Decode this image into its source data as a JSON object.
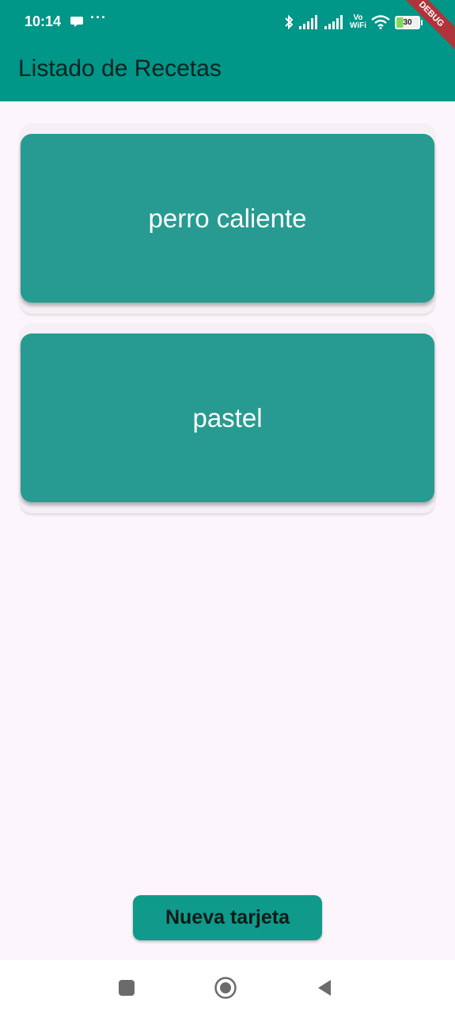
{
  "status_bar": {
    "time": "10:14",
    "more": "···",
    "icons": [
      "chat-bubble-icon",
      "bluetooth-icon",
      "signal-icon",
      "signal-icon",
      "vowifi-icon",
      "wifi-icon",
      "battery-icon"
    ],
    "vowifi_top": "Vo",
    "vowifi_bottom": "WiFi",
    "battery_level": "30",
    "battery_fraction": 0.3,
    "battery_color": "#7ed957"
  },
  "debug_banner": "DEBUG",
  "app_bar": {
    "title": "Listado de Recetas",
    "color": "#009688"
  },
  "cards": [
    {
      "label": "perro caliente"
    },
    {
      "label": "pastel"
    }
  ],
  "card_color": "#279b91",
  "new_card_button": {
    "label": "Nueva tarjeta"
  },
  "nav_bar": {
    "icons": [
      "recent-apps-icon",
      "home-icon",
      "back-icon"
    ]
  }
}
